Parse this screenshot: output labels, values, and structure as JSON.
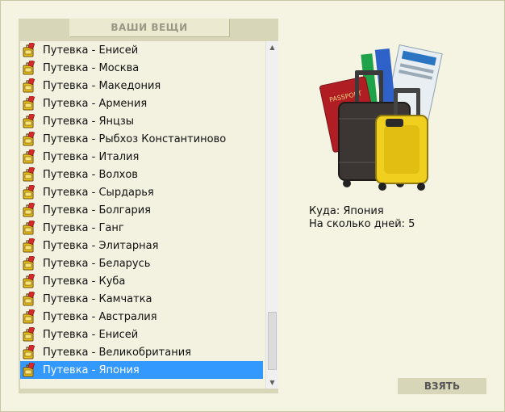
{
  "header": {
    "title": "ВАШИ ВЕЩИ"
  },
  "list": {
    "items": [
      "Путевка - Енисей",
      "Путевка - Москва",
      "Путевка - Македония",
      "Путевка - Армения",
      "Путевка - Янцзы",
      "Путевка - Рыбхоз Константиново",
      "Путевка - Италия",
      "Путевка - Волхов",
      "Путевка - Сырдарья",
      "Путевка - Болгария",
      "Путевка - Ганг",
      "Путевка - Элитарная",
      "Путевка - Беларусь",
      "Путевка - Куба",
      "Путевка - Камчатка",
      "Путевка - Австралия",
      "Путевка - Енисей",
      "Путевка - Великобритания",
      "Путевка - Япония"
    ],
    "selected_index": 18,
    "item_icon": "ticket-bag-icon"
  },
  "details": {
    "destination": "Куда: Япония",
    "days": "На сколько дней: 5",
    "image_icon": "luggage-passport-tickets-icon"
  },
  "actions": {
    "take_label": "ВЗЯТЬ"
  },
  "colors": {
    "selected": "#3399ff",
    "panel": "#d8d6b8",
    "background": "#f5f3e1"
  }
}
